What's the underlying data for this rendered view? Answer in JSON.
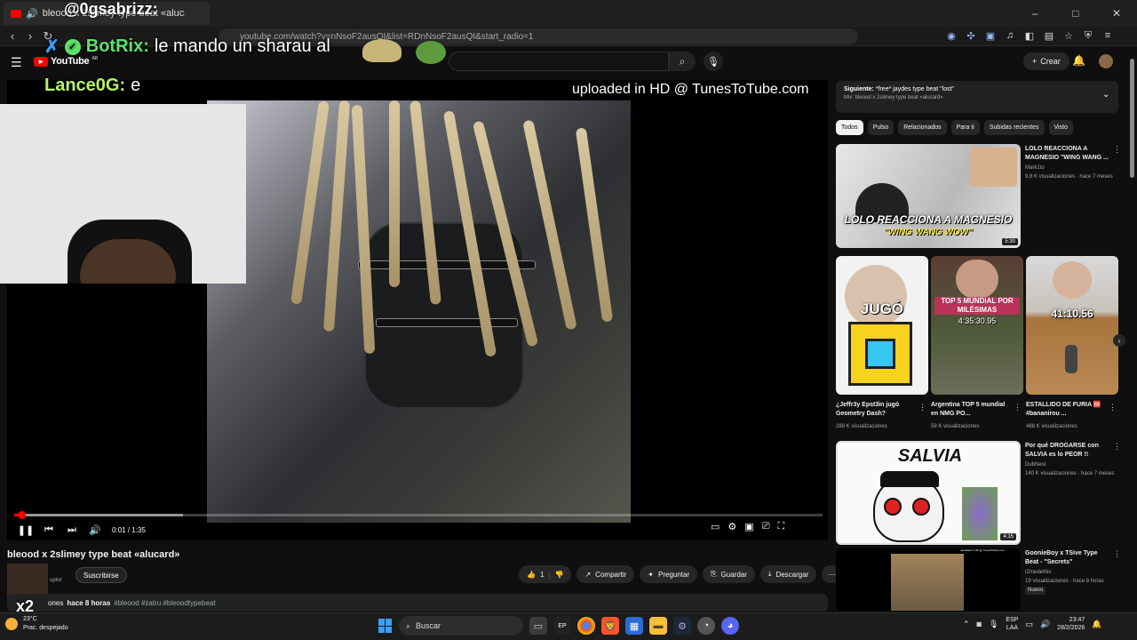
{
  "browser": {
    "tab_title": "bleood x 2slimey type beat «alucard»",
    "url": "youtube.com/watch?v=nNsoF2ausQI&list=RDnNsoF2ausQI&start_radio=1",
    "controls": {
      "minimize": "–",
      "maximize": "□",
      "close": "✕"
    }
  },
  "header": {
    "logo_text": "YouTube",
    "country": "AR",
    "create_label": "Crear"
  },
  "stream_overlay": {
    "top_user": "@0gsabrizz:",
    "chat": [
      {
        "user": "BotRix:",
        "message": "le mando un sharau al"
      },
      {
        "user": "Lance0G:",
        "message": "e"
      }
    ],
    "multiplier": "x2"
  },
  "player": {
    "watermark": "uploaded in HD @ TunesToTube.com",
    "time": "0:01 / 1:35",
    "progress_fraction": 0.006
  },
  "video": {
    "title": "bleood x 2slimey type beat «alucard»",
    "channel_subs": "uptor",
    "subscribe_label": "Suscribirse",
    "likes": "1",
    "share_label": "Compartir",
    "ask_label": "Preguntar",
    "save_label": "Guardar",
    "download_label": "Descargar",
    "desc_views": "ones",
    "desc_age": "hace 8 horas",
    "desc_tags": "#bleood #zatru #bleoodtypebeat"
  },
  "sidebar": {
    "next_up_prefix": "Siguiente:",
    "next_up_title": "*free* jaydes type beat \"lost\"",
    "next_up_mix": "Mix: bleood x 2slimey type beat «alucard»",
    "chips": [
      "Todos",
      "Pulso",
      "Relacionados",
      "Para ti",
      "Subidas recientes",
      "Visto"
    ],
    "items": [
      {
        "title": "LOLO REACCIONA A MAGNESIO \"WING WANG ...",
        "channel": "Mark1to",
        "meta": "9,8 K visualizaciones · hace 7 meses",
        "duration": "5:30",
        "thumb_text1": "LOLO REACCIONA A MAGNESIO",
        "thumb_text2": "\"WING WANG WOW\""
      },
      {
        "title": "Por qué DROGARSE con SALVIA es lo PEOR !!",
        "channel": "DubNest",
        "meta": "140 K visualizaciones · hace 7 meses",
        "duration": "4:15",
        "thumb_text1": "SALVIA"
      },
      {
        "title": "GoonieBoy x TSive Type Beat - \"Secrets\"",
        "channel": "t2medethis",
        "meta": "19 visualizaciones · hace 8 horas",
        "badge": "Nuevo",
        "thumb_text1": "uploaded in HD @ TunesToTube.com"
      }
    ],
    "shorts": [
      {
        "title": "¿Jeffr3y Epst3in jugó Geometry Dash?",
        "views": "289 K visualizaciones",
        "thumb_text": "JUGÓ"
      },
      {
        "title": "Argentina TOP 5 mundial en NMG PO...",
        "views": "59 K visualizaciones",
        "thumb_text1": "TOP 5 MUNDIAL POR MILÉSIMAS",
        "thumb_text2": "4:35:30.95"
      },
      {
        "title": "ESTALLIDO DE FURIA 🆘 #bananirou ...",
        "views": "488 K visualizaciones",
        "thumb_text": "41:10.56"
      }
    ]
  },
  "taskbar": {
    "temp": "23°C",
    "weather": "Prac. despejado",
    "search_placeholder": "Buscar",
    "lang1": "ESP",
    "lang2": "LAA",
    "time": "23:47",
    "date": "28/2/2026"
  },
  "colors": {
    "accent_red": "#ff0000",
    "bg": "#0f0f0f",
    "chip_bg": "#272727",
    "botrix_green": "#5ee36a"
  }
}
